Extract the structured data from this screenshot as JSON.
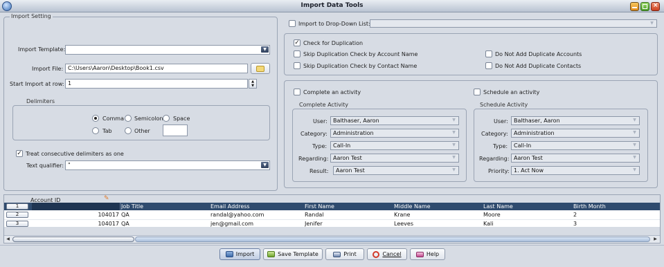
{
  "window": {
    "title": "Import Data Tools"
  },
  "import_setting": {
    "group_title": "Import Setting",
    "template_label": "Import Template:",
    "template_value": "",
    "file_label": "Import File:",
    "file_value": "C:\\Users\\Aaron\\Desktop\\Book1.csv",
    "start_row_label": "Start Import at row:",
    "start_row_value": "1",
    "delimiters": {
      "title": "Delimiters",
      "comma": "Comma",
      "semicolon": "Semicolon",
      "space": "Space",
      "tab": "Tab",
      "other": "Other",
      "other_value": "",
      "selected": "Comma"
    },
    "consecutive_label": "Treat consecutive delimiters as one",
    "consecutive_checked": true,
    "qualifier_label": "Text qualifier:",
    "qualifier_value": "\""
  },
  "dropdown": {
    "label": "Import to Drop-Down List:",
    "checked": false,
    "value": ""
  },
  "duplication": {
    "check_label": "Check for Duplication",
    "check_checked": true,
    "skip_account": "Skip Duplication Check by Account Name",
    "skip_contact": "Skip Duplication Check by Contact Name",
    "no_dup_accounts": "Do Not Add Duplicate Accounts",
    "no_dup_contacts": "Do Not Add Duplicate Contacts"
  },
  "activity": {
    "complete_check": "Complete an activity",
    "schedule_check": "Schedule an activity",
    "complete": {
      "title": "Complete Activity",
      "user_label": "User:",
      "user": "Balthaser, Aaron",
      "category_label": "Category:",
      "category": "Administration",
      "type_label": "Type:",
      "type": "Call-In",
      "regarding_label": "Regarding:",
      "regarding": "Aaron Test",
      "result_label": "Result:",
      "result": "Aaron Test"
    },
    "schedule": {
      "title": "Schedule Activity",
      "user_label": "User:",
      "user": "Balthaser, Aaron",
      "category_label": "Category:",
      "category": "Administration",
      "type_label": "Type:",
      "type": "Call-In",
      "regarding_label": "Regarding:",
      "regarding": "Aaron Test",
      "priority_label": "Priority:",
      "priority": "1. Act Now"
    }
  },
  "grid": {
    "mapping_header": "Account ID",
    "columns": [
      "Job Title",
      "Email Address",
      "First Name",
      "Middle Name",
      "Last Name",
      "Birth Month"
    ],
    "row_numbers": [
      "1",
      "2",
      "3"
    ],
    "rows": [
      {
        "account": "104017",
        "job": "QA",
        "email": "randal@yahoo.com",
        "first": "Randal",
        "middle": "Krane",
        "last": "Moore",
        "birth": "2"
      },
      {
        "account": "104017",
        "job": "QA",
        "email": "jen@gmail.com",
        "first": "Jenifer",
        "middle": "Leeves",
        "last": "Kali",
        "birth": "3"
      }
    ]
  },
  "buttons": {
    "import": "Import",
    "save_template": "Save Template",
    "print": "Print",
    "cancel": "Cancel",
    "help": "Help"
  }
}
